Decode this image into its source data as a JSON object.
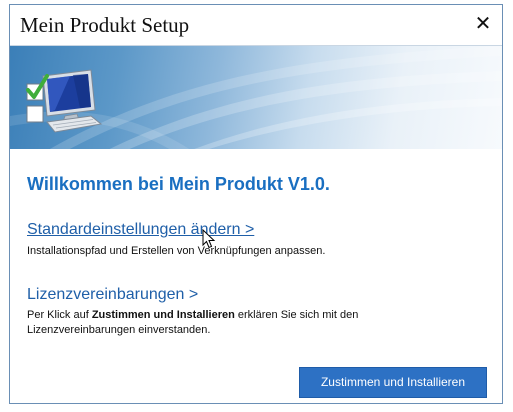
{
  "window": {
    "title": "Mein Produkt Setup",
    "close_glyph": "✕"
  },
  "banner": {
    "icon": "computer-checkmark-icon"
  },
  "main": {
    "welcome": "Willkommen bei Mein Produkt V1.0.",
    "options": [
      {
        "label": "Standardeinstellungen ändern >",
        "description": "Installationspfad und Erstellen von Verknüpfungen anpassen."
      },
      {
        "label": "Lizenzvereinbarungen >",
        "description_prefix": "Per Klick auf ",
        "description_bold": "Zustimmen und Installieren",
        "description_suffix": " erklären Sie sich mit den Lizenzvereinbarungen einverstanden."
      }
    ],
    "install_button": "Zustimmen und Installieren"
  },
  "colors": {
    "accent": "#1a6fc1",
    "link": "#1f5fa8",
    "button": "#2d71c4",
    "check": "#3fae3a"
  }
}
